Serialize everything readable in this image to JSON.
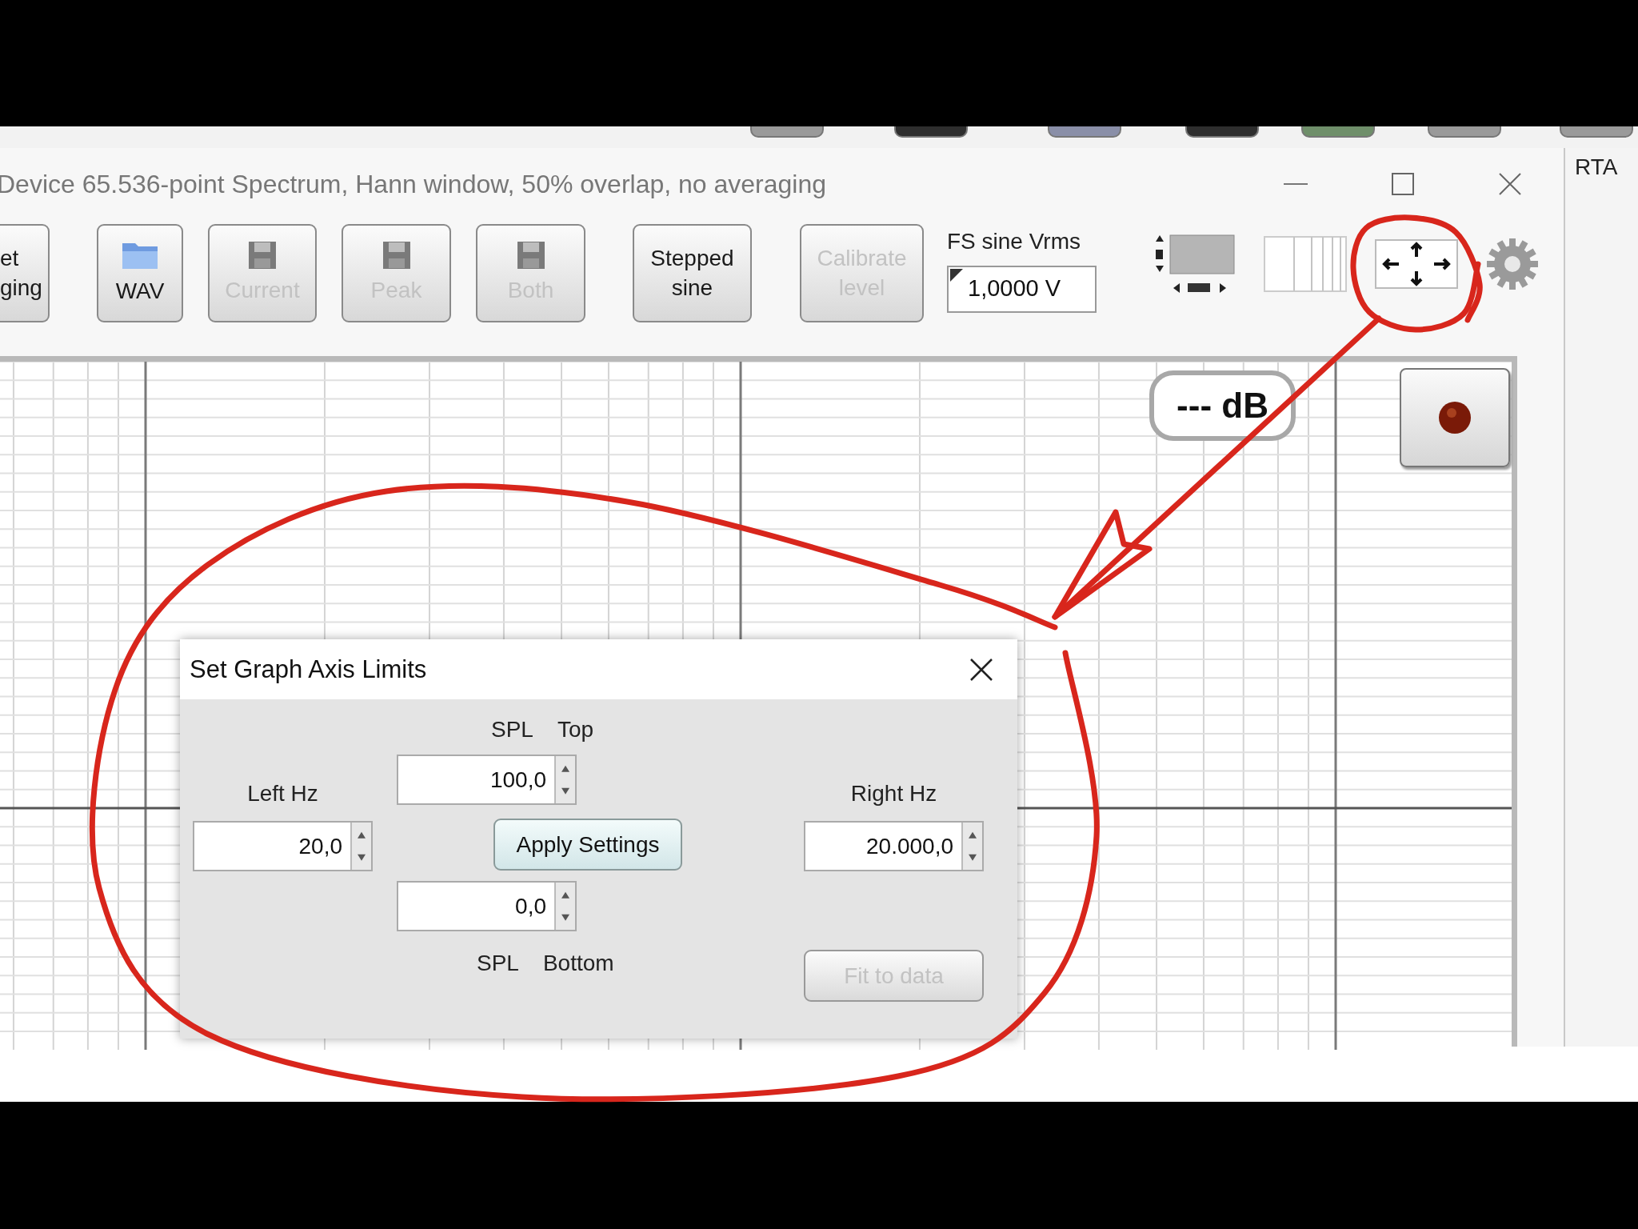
{
  "top_strip": {
    "buttons": [
      {
        "kind": "plain"
      },
      {
        "kind": "dark"
      },
      {
        "kind": "blue"
      },
      {
        "kind": "dark"
      },
      {
        "kind": "green"
      },
      {
        "kind": "plain"
      },
      {
        "kind": "plain"
      }
    ]
  },
  "window": {
    "title": "Device 65.536-point Spectrum, Hann window, 50% overlap, no averaging"
  },
  "side_panel": {
    "label": "RTA"
  },
  "toolbar": {
    "buttons": [
      {
        "kind": "text",
        "lines": [
          "et",
          "ging"
        ],
        "disabled": false
      },
      {
        "kind": "folder",
        "lines": [
          "WAV"
        ],
        "disabled": false
      },
      {
        "kind": "save",
        "lines": [
          "Current"
        ],
        "disabled": true
      },
      {
        "kind": "save",
        "lines": [
          "Peak"
        ],
        "disabled": true
      },
      {
        "kind": "save",
        "lines": [
          "Both"
        ],
        "disabled": true
      },
      {
        "kind": "text",
        "lines": [
          "Stepped",
          "sine"
        ],
        "disabled": false
      },
      {
        "kind": "text",
        "lines": [
          "Calibrate",
          "level"
        ],
        "disabled": true
      }
    ],
    "fs_sine": {
      "label": "FS sine Vrms",
      "value": "1,0000 V"
    }
  },
  "graph": {
    "level_readout": "--- dB"
  },
  "dialog": {
    "title": "Set Graph Axis Limits",
    "top_labels": [
      "SPL",
      "Top"
    ],
    "top_value": "100,0",
    "left_label": "Left Hz",
    "left_value": "20,0",
    "apply": {
      "label": "Apply Settings",
      "disabled": false
    },
    "right_label": "Right Hz",
    "right_value": "20.000,0",
    "bottom_value": "0,0",
    "bottom_labels": [
      "SPL",
      "Bottom"
    ],
    "fit": {
      "label": "Fit to data",
      "disabled": true
    }
  }
}
